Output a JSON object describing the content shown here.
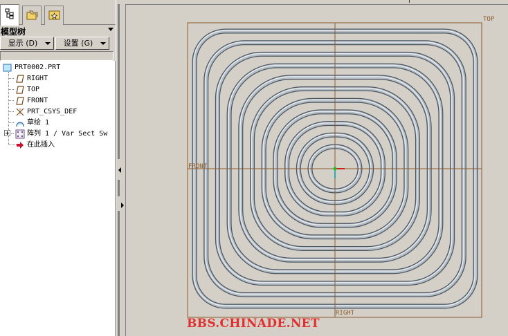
{
  "left_panel": {
    "tabs": [
      {
        "name": "model-tree-tab",
        "icon": "model-tree-icon",
        "active": true
      },
      {
        "name": "folder-browser-tab",
        "icon": "folder-browser-icon",
        "active": false
      },
      {
        "name": "favorites-tab",
        "icon": "favorites-icon",
        "active": false
      }
    ],
    "title": "模型树",
    "show_button": "显示 (D)",
    "settings_button": "设置 (G)"
  },
  "tree": {
    "root": "PRT0002.PRT",
    "items": [
      {
        "label": "RIGHT",
        "icon": "datum-plane-icon"
      },
      {
        "label": "TOP",
        "icon": "datum-plane-icon"
      },
      {
        "label": "FRONT",
        "icon": "datum-plane-icon"
      },
      {
        "label": "PRT_CSYS_DEF",
        "icon": "coordinate-system-icon"
      },
      {
        "label": "草绘 1",
        "icon": "sketch-icon"
      },
      {
        "label": "阵列 1 / Var Sect Sw",
        "icon": "pattern-icon"
      },
      {
        "label": "在此插入",
        "icon": "insert-here-arrow-icon"
      }
    ]
  },
  "graphics": {
    "plane_labels": {
      "top": "TOP",
      "front": "FRONT",
      "right": "RIGHT"
    },
    "watermark": "BBS.CHINADE.NET",
    "colors": {
      "background": "#d4d0c8",
      "datum_plane": "#8a5a2a",
      "tube_edge": "#4a5560",
      "tube_fill": "#b4bcc4",
      "tube_highlight": "#e8ecef",
      "watermark": "#e0302f"
    },
    "tube_count": 11
  }
}
